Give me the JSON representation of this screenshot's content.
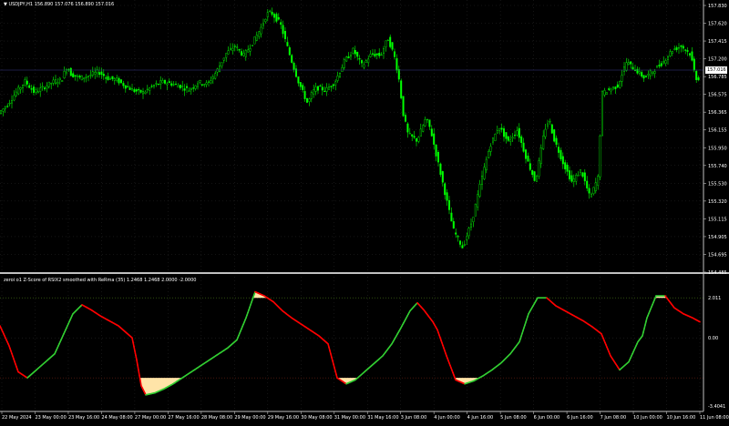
{
  "colors": {
    "background": "#000000",
    "grid": "#2a2a2a",
    "bull_candle": "#00ff00",
    "bear_candle": "#00ff00",
    "indicator_up": "#32cd32",
    "indicator_down": "#ff0000",
    "fill": "#ffe4a8",
    "axis_text": "#ffffff",
    "current_price_line": "#3a3a8a",
    "level_upper": "#4a7a1a",
    "level_lower": "#8a2a1a",
    "separator": "#c0c0c0"
  },
  "price_panel": {
    "symbol_label": "USDJPY,H1  156.890 157.076 156.890 157.016",
    "current_price": "157.016",
    "price_axis_labels": [
      "157.830",
      "157.620",
      "157.415",
      "157.200",
      "157.016",
      "156.785",
      "156.575",
      "156.365",
      "156.155",
      "155.950",
      "155.740",
      "155.530",
      "155.320",
      "155.115",
      "154.905",
      "154.695",
      "154.485"
    ],
    "ylim": [
      154.485,
      157.83
    ]
  },
  "indicator_panel": {
    "title": "zeroi o1 Z-Score of RSIX2 smoothed with ReRma (35) 1.2468 1.2468 2.0000 -2.0000",
    "axis_labels": [
      "2.011",
      "0.00",
      "-3.4041"
    ],
    "levels": [
      2.0,
      -2.0
    ],
    "ylim": [
      -3.4041,
      2.6
    ]
  },
  "time_axis_labels": [
    "22 May 2024",
    "23 May 00:00",
    "23 May 16:00",
    "24 May 08:00",
    "27 May 00:00",
    "27 May 16:00",
    "28 May 08:00",
    "29 May 00:00",
    "29 May 16:00",
    "30 May 08:00",
    "31 May 00:00",
    "31 May 16:00",
    "3 Jun 08:00",
    "4 Jun 00:00",
    "4 Jun 16:00",
    "5 Jun 08:00",
    "6 Jun 00:00",
    "6 Jun 16:00",
    "7 Jun 08:00",
    "10 Jun 00:00",
    "10 Jun 16:00",
    "11 Jun 08:00"
  ],
  "chart_data": [
    {
      "type": "line",
      "title": "USDJPY,H1  156.890 157.076 156.890 157.016",
      "price_path": [
        [
          0,
          156.45
        ],
        [
          10,
          156.56
        ],
        [
          20,
          156.72
        ],
        [
          30,
          156.86
        ],
        [
          40,
          156.72
        ],
        [
          50,
          156.78
        ],
        [
          60,
          156.85
        ],
        [
          70,
          156.88
        ],
        [
          76,
          157.05
        ],
        [
          80,
          156.95
        ],
        [
          90,
          156.9
        ],
        [
          100,
          156.93
        ],
        [
          110,
          156.98
        ],
        [
          120,
          156.9
        ],
        [
          130,
          156.88
        ],
        [
          140,
          156.8
        ],
        [
          150,
          156.74
        ],
        [
          160,
          156.72
        ],
        [
          170,
          156.8
        ],
        [
          180,
          156.85
        ],
        [
          190,
          156.83
        ],
        [
          200,
          156.8
        ],
        [
          210,
          156.75
        ],
        [
          220,
          156.85
        ],
        [
          230,
          156.82
        ],
        [
          240,
          156.98
        ],
        [
          250,
          157.2
        ],
        [
          260,
          157.3
        ],
        [
          270,
          157.18
        ],
        [
          280,
          157.35
        ],
        [
          290,
          157.55
        ],
        [
          295,
          157.7
        ],
        [
          300,
          157.72
        ],
        [
          310,
          157.58
        ],
        [
          320,
          157.2
        ],
        [
          330,
          156.85
        ],
        [
          340,
          156.58
        ],
        [
          345,
          156.72
        ],
        [
          350,
          156.78
        ],
        [
          360,
          156.75
        ],
        [
          370,
          156.85
        ],
        [
          380,
          157.1
        ],
        [
          390,
          157.25
        ],
        [
          400,
          157.05
        ],
        [
          410,
          157.2
        ],
        [
          420,
          157.18
        ],
        [
          428,
          157.4
        ],
        [
          435,
          157.18
        ],
        [
          440,
          156.9
        ],
        [
          445,
          156.45
        ],
        [
          450,
          156.2
        ],
        [
          460,
          156.12
        ],
        [
          470,
          156.4
        ],
        [
          475,
          156.25
        ],
        [
          480,
          156.0
        ],
        [
          490,
          155.5
        ],
        [
          500,
          155.0
        ],
        [
          510,
          154.78
        ],
        [
          520,
          155.1
        ],
        [
          530,
          155.6
        ],
        [
          540,
          156.05
        ],
        [
          550,
          156.3
        ],
        [
          560,
          156.1
        ],
        [
          570,
          156.25
        ],
        [
          580,
          155.9
        ],
        [
          590,
          155.6
        ],
        [
          600,
          156.25
        ],
        [
          605,
          156.38
        ],
        [
          610,
          156.15
        ],
        [
          620,
          155.85
        ],
        [
          630,
          155.6
        ],
        [
          640,
          155.75
        ],
        [
          650,
          155.4
        ],
        [
          655,
          155.55
        ],
        [
          660,
          155.7
        ],
        [
          662,
          156.7
        ],
        [
          670,
          156.75
        ],
        [
          680,
          156.8
        ],
        [
          690,
          157.1
        ],
        [
          700,
          157.0
        ],
        [
          710,
          156.9
        ],
        [
          720,
          157.0
        ],
        [
          730,
          157.1
        ],
        [
          740,
          157.25
        ],
        [
          750,
          157.3
        ],
        [
          760,
          157.2
        ],
        [
          766,
          156.9
        ]
      ]
    },
    {
      "type": "line",
      "title": "zeroi o1 Z-Score of RSIX2 smoothed with ReRma (35) 1.2468 1.2468 2.0000 -2.0000",
      "levels": [
        2.0,
        -2.0
      ],
      "zscore_path": [
        [
          0,
          0.6
        ],
        [
          10,
          -0.4
        ],
        [
          20,
          -1.7
        ],
        [
          30,
          -2.0
        ],
        [
          40,
          -1.6
        ],
        [
          50,
          -1.2
        ],
        [
          60,
          -0.8
        ],
        [
          70,
          0.2
        ],
        [
          80,
          1.2
        ],
        [
          90,
          1.65
        ],
        [
          100,
          1.4
        ],
        [
          110,
          1.1
        ],
        [
          120,
          0.85
        ],
        [
          130,
          0.6
        ],
        [
          140,
          0.2
        ],
        [
          145,
          0.0
        ],
        [
          150,
          -1.1
        ],
        [
          155,
          -2.4
        ],
        [
          160,
          -2.85
        ],
        [
          170,
          -2.75
        ],
        [
          180,
          -2.55
        ],
        [
          190,
          -2.3
        ],
        [
          200,
          -2.0
        ],
        [
          210,
          -1.7
        ],
        [
          220,
          -1.4
        ],
        [
          230,
          -1.1
        ],
        [
          240,
          -0.8
        ],
        [
          250,
          -0.5
        ],
        [
          260,
          -0.1
        ],
        [
          270,
          1.0
        ],
        [
          280,
          2.3
        ],
        [
          290,
          2.1
        ],
        [
          300,
          1.8
        ],
        [
          310,
          1.35
        ],
        [
          320,
          1.0
        ],
        [
          330,
          0.7
        ],
        [
          340,
          0.4
        ],
        [
          350,
          0.1
        ],
        [
          360,
          -0.3
        ],
        [
          370,
          -2.0
        ],
        [
          380,
          -2.3
        ],
        [
          390,
          -2.1
        ],
        [
          400,
          -1.7
        ],
        [
          410,
          -1.3
        ],
        [
          420,
          -0.9
        ],
        [
          430,
          -0.3
        ],
        [
          440,
          0.5
        ],
        [
          450,
          1.35
        ],
        [
          458,
          1.75
        ],
        [
          465,
          1.4
        ],
        [
          475,
          0.8
        ],
        [
          480,
          0.4
        ],
        [
          490,
          -0.9
        ],
        [
          500,
          -2.1
        ],
        [
          510,
          -2.3
        ],
        [
          520,
          -2.15
        ],
        [
          530,
          -1.9
        ],
        [
          540,
          -1.6
        ],
        [
          550,
          -1.25
        ],
        [
          560,
          -0.8
        ],
        [
          570,
          -0.2
        ],
        [
          580,
          1.2
        ],
        [
          590,
          2.0
        ],
        [
          600,
          2.0
        ],
        [
          610,
          1.6
        ],
        [
          620,
          1.35
        ],
        [
          630,
          1.1
        ],
        [
          640,
          0.85
        ],
        [
          650,
          0.55
        ],
        [
          660,
          0.2
        ],
        [
          670,
          -0.9
        ],
        [
          680,
          -1.6
        ],
        [
          690,
          -1.2
        ],
        [
          700,
          -0.2
        ],
        [
          705,
          0.1
        ],
        [
          710,
          1.0
        ],
        [
          720,
          2.1
        ],
        [
          730,
          2.1
        ],
        [
          740,
          1.5
        ],
        [
          750,
          1.2
        ],
        [
          760,
          1.0
        ],
        [
          768,
          0.8
        ]
      ]
    }
  ]
}
